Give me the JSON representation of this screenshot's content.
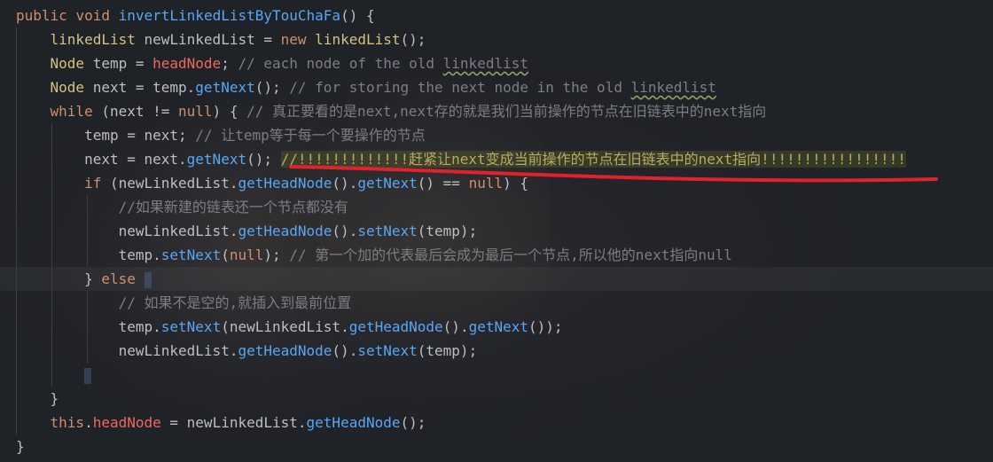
{
  "colors": {
    "background": "#1f2227",
    "keyword": "#cf8e6d",
    "method": "#56a8f5",
    "field": "#c77dbb",
    "type": "#d6c280",
    "comment": "#7a7e85",
    "annotation_red": "#e0222a"
  },
  "code": {
    "l1": {
      "kw1": "public",
      "kw2": "void",
      "name": "invertLinkedListByTouChaFa",
      "rest": "() {"
    },
    "l2": {
      "type": "linkedList",
      "var": " newLinkedList = ",
      "kw": "new",
      "ctor": "linkedList",
      "rest": "();"
    },
    "l3": {
      "type": "Node",
      "var": " temp = ",
      "field": "headNode",
      "semi": ";",
      "comment1": " // each node of the old ",
      "comment2": "linkedlist"
    },
    "l4": {
      "type": "Node",
      "var": " next = temp.",
      "method": "getNext",
      "rest": "();",
      "comment1": " // for storing the next node in the old ",
      "comment2": "linkedlist"
    },
    "l5": {
      "kw": "while",
      "cond1": " (next != ",
      "null": "null",
      "cond2": ") {",
      "comment": " // 真正要看的是next,next存的就是我们当前操作的节点在旧链表中的next指向"
    },
    "l6": {
      "code": "temp = next;",
      "comment": " // 让temp等于每一个要操作的节点"
    },
    "l7": {
      "code1": "next = next.",
      "method": "getNext",
      "code2": "(); ",
      "comment": "//!!!!!!!!!!!!!赶紧让next变成当前操作的节点在旧链表中的next指向!!!!!!!!!!!!!!!!!"
    },
    "l8": {
      "kw": "if",
      "c1": " (newLinkedList.",
      "m1": "getHeadNode",
      "c2": "().",
      "m2": "getNext",
      "c3": "() == ",
      "null": "null",
      "c4": ") {"
    },
    "l9": {
      "comment": "//如果新建的链表还一个节点都没有"
    },
    "l10": {
      "c1": "newLinkedList.",
      "m1": "getHeadNode",
      "c2": "().",
      "m2": "setNext",
      "c3": "(temp);"
    },
    "l11": {
      "c1": "temp.",
      "m1": "setNext",
      "c2": "(",
      "null": "null",
      "c3": ");",
      "comment": " // 第一个加的代表最后会成为最后一个节点,所以他的next指向null"
    },
    "l12": {
      "brace": "}",
      "kw": "else",
      "brace2": "{"
    },
    "l13": {
      "comment": "// 如果不是空的,就插入到最前位置"
    },
    "l14": {
      "c1": "temp.",
      "m1": "setNext",
      "c2": "(newLinkedList.",
      "m2": "getHeadNode",
      "c3": "().",
      "m3": "getNext",
      "c4": "());"
    },
    "l15": {
      "c1": "newLinkedList.",
      "m1": "getHeadNode",
      "c2": "().",
      "m2": "setNext",
      "c3": "(temp);"
    },
    "l16": {
      "brace": "}"
    },
    "l17": {
      "brace": "}"
    },
    "l18": {
      "kw": "this",
      "dot": ".",
      "field": "headNode",
      "c1": " = newLinkedList.",
      "m1": "getHeadNode",
      "c2": "();"
    },
    "l19": {
      "brace": "}"
    }
  }
}
